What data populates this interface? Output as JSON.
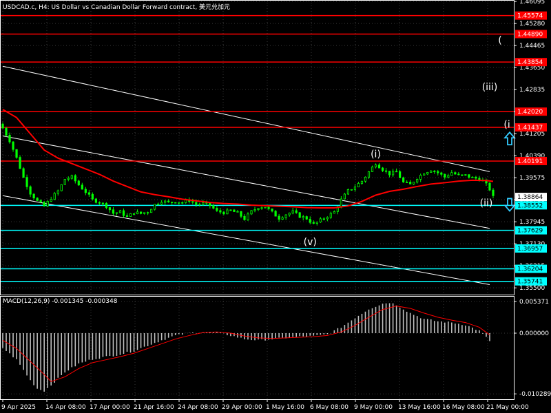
{
  "header": {
    "title": "USDCAD.c, H4: US Dollar vs Canadian Dollar Forward contract, 美元兑加元"
  },
  "macd": {
    "label": "MACD(12,26,9) -0.001345 -0.000348",
    "ticks": [
      "0.005371",
      "0.000000",
      "-0.010289"
    ],
    "tick_values": [
      0.005371,
      0.0,
      -0.010289
    ]
  },
  "colors": {
    "background": "#000000",
    "grid": "#3a3a3a",
    "candle": "#00ff00",
    "ma": "#ff0000",
    "resistance": "#ff0000",
    "support": "#00ffff",
    "channel": "#ffffff",
    "histogram": "#c0c0c0",
    "signal": "#ff0000",
    "arrow": "#33ccff",
    "price_badge": "#ffffff"
  },
  "chart_data": {
    "type": "candlestick",
    "symbol": "USDCAD.c",
    "timeframe": "H4",
    "ylim": [
      1.3525,
      1.4615
    ],
    "y_ticks": [
      1.46095,
      1.4528,
      1.44465,
      1.4365,
      1.42835,
      1.4202,
      1.41205,
      1.4039,
      1.39575,
      1.3876,
      1.37945,
      1.3713,
      1.36315,
      1.355
    ],
    "y_tick_labels": [
      "1.46095",
      "1.45280",
      "1.44465",
      "1.43650",
      "1.42835",
      "1.42020",
      "1.41205",
      "1.40390",
      "1.39575",
      "1.38760",
      "1.37945",
      "1.37130",
      "1.36315",
      "1.35500"
    ],
    "x_tick_labels": [
      "9 Apr 2025",
      "14 Apr 08:00",
      "17 Apr 00:00",
      "21 Apr 16:00",
      "24 Apr 08:00",
      "29 Apr 00:00",
      "1 May 16:00",
      "6 May 08:00",
      "9 May 00:00",
      "13 May 16:00",
      "16 May 08:00",
      "21 May 00:00"
    ],
    "current_price": 1.38864,
    "resistance_levels": [
      {
        "value": 1.45574,
        "label": "1.45574"
      },
      {
        "value": 1.4489,
        "label": "1.44890"
      },
      {
        "value": 1.43854,
        "label": "1.43854"
      },
      {
        "value": 1.4202,
        "label": "1.42020"
      },
      {
        "value": 1.41437,
        "label": "1.41437"
      },
      {
        "value": 1.40191,
        "label": "1.40191"
      }
    ],
    "support_levels": [
      {
        "value": 1.38552,
        "label": "1.38552"
      },
      {
        "value": 1.37629,
        "label": "1.37629"
      },
      {
        "value": 1.36957,
        "label": "1.36957"
      },
      {
        "value": 1.36204,
        "label": "1.36204"
      },
      {
        "value": 1.35741,
        "label": "1.35741"
      }
    ],
    "wave_labels": [
      {
        "text": "(",
        "x_index": 144,
        "price": 1.4455
      },
      {
        "text": "(iii)",
        "x_index": 141,
        "price": 1.4282
      },
      {
        "text": "(i",
        "x_index": 146,
        "price": 1.4142
      },
      {
        "text": "(i)",
        "x_index": 108,
        "price": 1.4033
      },
      {
        "text": "(ii)",
        "x_index": 140,
        "price": 1.3852
      },
      {
        "text": "(v)",
        "x_index": 89,
        "price": 1.3708
      }
    ],
    "close_path": [
      [
        0,
        1.4141
      ],
      [
        2,
        1.4095
      ],
      [
        4,
        1.4031
      ],
      [
        6,
        1.3958
      ],
      [
        8,
        1.3901
      ],
      [
        10,
        1.3871
      ],
      [
        12,
        1.3852
      ],
      [
        14,
        1.3882
      ],
      [
        16,
        1.3908
      ],
      [
        18,
        1.3952
      ],
      [
        20,
        1.396
      ],
      [
        22,
        1.3931
      ],
      [
        24,
        1.3905
      ],
      [
        26,
        1.3876
      ],
      [
        28,
        1.3867
      ],
      [
        30,
        1.3853
      ],
      [
        32,
        1.3826
      ],
      [
        34,
        1.3831
      ],
      [
        36,
        1.3812
      ],
      [
        38,
        1.3829
      ],
      [
        40,
        1.3825
      ],
      [
        42,
        1.3832
      ],
      [
        44,
        1.3858
      ],
      [
        46,
        1.3872
      ],
      [
        48,
        1.3865
      ],
      [
        50,
        1.387
      ],
      [
        52,
        1.3866
      ],
      [
        54,
        1.3874
      ],
      [
        56,
        1.3859
      ],
      [
        58,
        1.3862
      ],
      [
        60,
        1.3855
      ],
      [
        62,
        1.3833
      ],
      [
        64,
        1.3829
      ],
      [
        66,
        1.3836
      ],
      [
        68,
        1.3827
      ],
      [
        70,
        1.3805
      ],
      [
        72,
        1.3832
      ],
      [
        74,
        1.3849
      ],
      [
        76,
        1.385
      ],
      [
        78,
        1.3829
      ],
      [
        80,
        1.3808
      ],
      [
        82,
        1.3822
      ],
      [
        84,
        1.3831
      ],
      [
        86,
        1.3815
      ],
      [
        88,
        1.3807
      ],
      [
        90,
        1.3785
      ],
      [
        92,
        1.38
      ],
      [
        94,
        1.3815
      ],
      [
        96,
        1.3831
      ],
      [
        98,
        1.3876
      ],
      [
        100,
        1.3909
      ],
      [
        102,
        1.3925
      ],
      [
        104,
        1.3945
      ],
      [
        106,
        1.3979
      ],
      [
        108,
        1.4011
      ],
      [
        110,
        1.3988
      ],
      [
        112,
        1.3972
      ],
      [
        114,
        1.3979
      ],
      [
        116,
        1.394
      ],
      [
        118,
        1.3932
      ],
      [
        120,
        1.3957
      ],
      [
        122,
        1.3976
      ],
      [
        124,
        1.3987
      ],
      [
        126,
        1.3976
      ],
      [
        128,
        1.396
      ],
      [
        130,
        1.3977
      ],
      [
        132,
        1.3965
      ],
      [
        134,
        1.3966
      ],
      [
        136,
        1.3957
      ],
      [
        138,
        1.3954
      ],
      [
        140,
        1.3932
      ],
      [
        141,
        1.3915
      ],
      [
        142,
        1.3886
      ]
    ],
    "ma_path": [
      [
        0,
        1.421
      ],
      [
        4,
        1.418
      ],
      [
        8,
        1.412
      ],
      [
        12,
        1.406
      ],
      [
        16,
        1.403
      ],
      [
        20,
        1.401
      ],
      [
        24,
        1.399
      ],
      [
        28,
        1.397
      ],
      [
        32,
        1.3945
      ],
      [
        36,
        1.3925
      ],
      [
        40,
        1.3905
      ],
      [
        44,
        1.3895
      ],
      [
        48,
        1.3887
      ],
      [
        52,
        1.3878
      ],
      [
        56,
        1.3872
      ],
      [
        60,
        1.3866
      ],
      [
        64,
        1.3862
      ],
      [
        68,
        1.386
      ],
      [
        72,
        1.3856
      ],
      [
        76,
        1.3854
      ],
      [
        80,
        1.3852
      ],
      [
        84,
        1.385
      ],
      [
        88,
        1.3847
      ],
      [
        92,
        1.3846
      ],
      [
        96,
        1.3846
      ],
      [
        100,
        1.3853
      ],
      [
        104,
        1.387
      ],
      [
        108,
        1.3893
      ],
      [
        112,
        1.3907
      ],
      [
        116,
        1.3915
      ],
      [
        120,
        1.3925
      ],
      [
        124,
        1.3934
      ],
      [
        128,
        1.3939
      ],
      [
        132,
        1.3945
      ],
      [
        136,
        1.3948
      ],
      [
        140,
        1.3947
      ],
      [
        142,
        1.3944
      ]
    ],
    "channels": [
      {
        "from": [
          0,
          1.437
        ],
        "to": [
          141,
          1.398
        ]
      },
      {
        "from": [
          0,
          1.4112
        ],
        "to": [
          141,
          1.377
        ]
      },
      {
        "from": [
          0,
          1.3891
        ],
        "to": [
          141,
          1.3562
        ]
      }
    ],
    "macd_histogram_path": [
      [
        0,
        -0.0025
      ],
      [
        4,
        -0.0045
      ],
      [
        8,
        -0.008
      ],
      [
        10,
        -0.0094
      ],
      [
        12,
        -0.0098
      ],
      [
        14,
        -0.0088
      ],
      [
        18,
        -0.0066
      ],
      [
        22,
        -0.0052
      ],
      [
        26,
        -0.0044
      ],
      [
        30,
        -0.004
      ],
      [
        34,
        -0.0036
      ],
      [
        38,
        -0.003
      ],
      [
        42,
        -0.0021
      ],
      [
        46,
        -0.0012
      ],
      [
        50,
        -0.0004
      ],
      [
        54,
        0.0
      ],
      [
        58,
        0.0002
      ],
      [
        62,
        0.0001
      ],
      [
        66,
        -0.0004
      ],
      [
        70,
        -0.001
      ],
      [
        74,
        -0.0012
      ],
      [
        78,
        -0.001
      ],
      [
        82,
        -0.0008
      ],
      [
        86,
        -0.0006
      ],
      [
        90,
        -0.0005
      ],
      [
        94,
        -0.0002
      ],
      [
        98,
        0.001
      ],
      [
        102,
        0.0026
      ],
      [
        106,
        0.0041
      ],
      [
        110,
        0.005
      ],
      [
        112,
        0.0052
      ],
      [
        114,
        0.0048
      ],
      [
        118,
        0.0034
      ],
      [
        122,
        0.0024
      ],
      [
        126,
        0.002
      ],
      [
        130,
        0.0018
      ],
      [
        134,
        0.0014
      ],
      [
        138,
        0.0004
      ],
      [
        141,
        -0.0013
      ]
    ],
    "macd_signal_path": [
      [
        0,
        -0.0012
      ],
      [
        4,
        -0.0026
      ],
      [
        8,
        -0.0048
      ],
      [
        12,
        -0.007
      ],
      [
        14,
        -0.0082
      ],
      [
        18,
        -0.0074
      ],
      [
        22,
        -0.006
      ],
      [
        26,
        -0.005
      ],
      [
        30,
        -0.0045
      ],
      [
        34,
        -0.004
      ],
      [
        38,
        -0.0034
      ],
      [
        42,
        -0.0026
      ],
      [
        46,
        -0.0018
      ],
      [
        50,
        -0.001
      ],
      [
        54,
        -0.0004
      ],
      [
        58,
        0.0001
      ],
      [
        62,
        0.0002
      ],
      [
        66,
        0.0
      ],
      [
        70,
        -0.0005
      ],
      [
        74,
        -0.0008
      ],
      [
        78,
        -0.0009
      ],
      [
        82,
        -0.0008
      ],
      [
        86,
        -0.0007
      ],
      [
        90,
        -0.0006
      ],
      [
        94,
        -0.0004
      ],
      [
        98,
        0.0002
      ],
      [
        102,
        0.0013
      ],
      [
        106,
        0.0027
      ],
      [
        110,
        0.004
      ],
      [
        114,
        0.0046
      ],
      [
        118,
        0.0042
      ],
      [
        122,
        0.0034
      ],
      [
        126,
        0.0027
      ],
      [
        130,
        0.0022
      ],
      [
        134,
        0.0018
      ],
      [
        138,
        0.001
      ],
      [
        141,
        -0.0003
      ]
    ],
    "arrows": [
      {
        "direction": "up",
        "x_index": 144,
        "price": 1.41
      },
      {
        "direction": "down",
        "x_index": 144,
        "price": 1.386
      }
    ]
  }
}
